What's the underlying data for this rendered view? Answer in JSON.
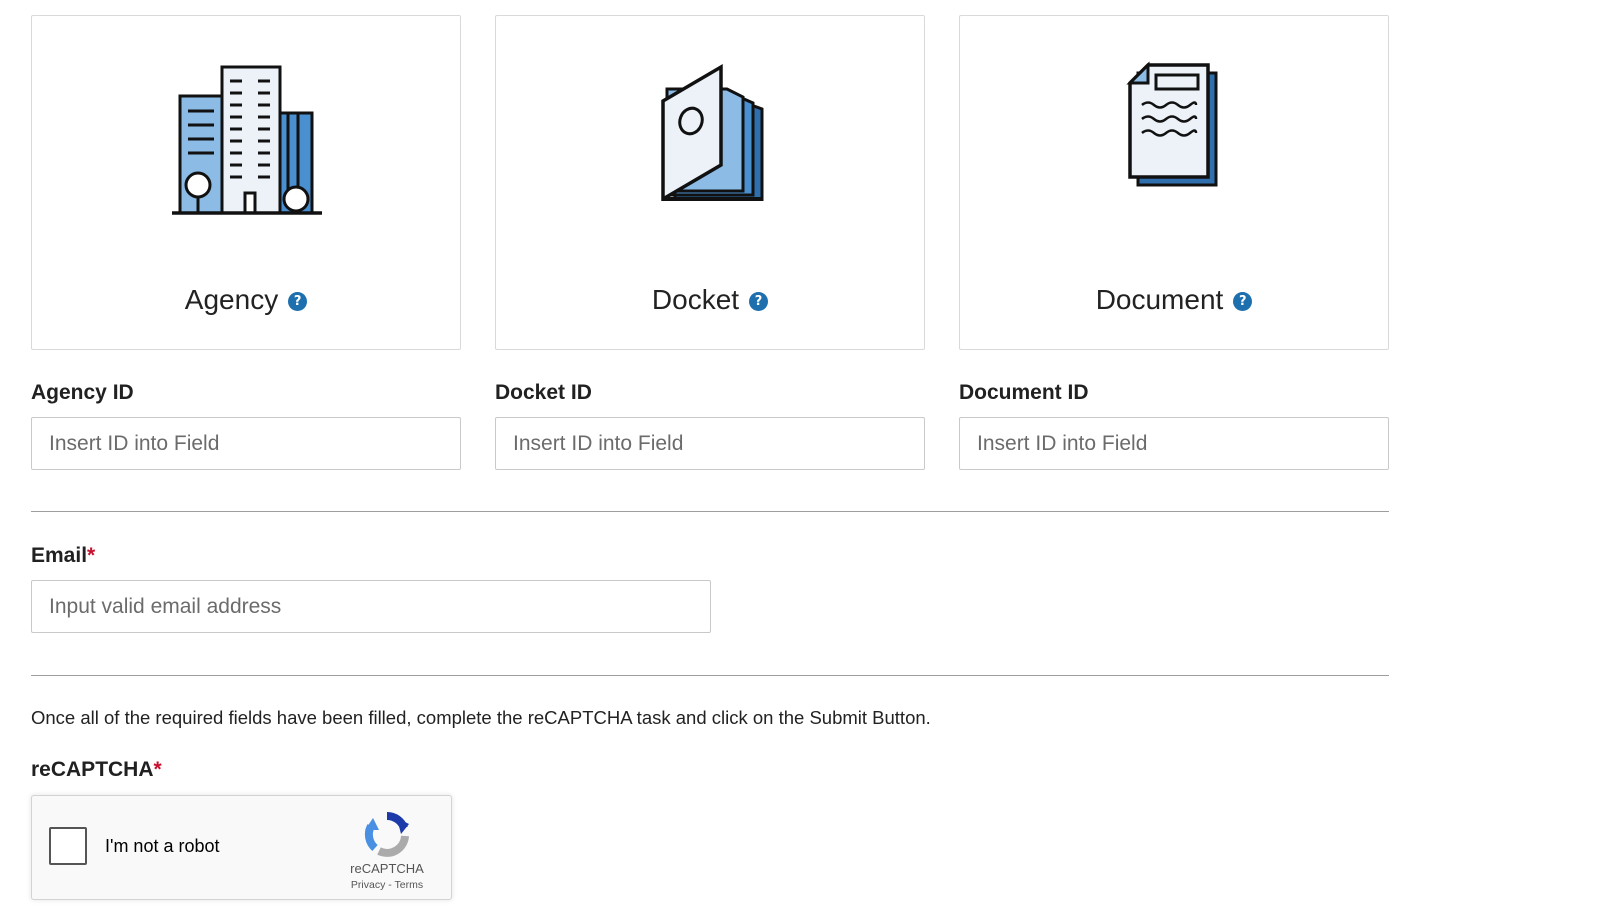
{
  "cards": [
    {
      "title": "Agency",
      "icon": "building-icon",
      "help_icon": "question-circle-icon"
    },
    {
      "title": "Docket",
      "icon": "docket-folders-icon",
      "help_icon": "question-circle-icon"
    },
    {
      "title": "Document",
      "icon": "document-pages-icon",
      "help_icon": "question-circle-icon"
    }
  ],
  "id_fields": [
    {
      "label": "Agency ID",
      "value": "",
      "placeholder": "Insert ID into Field"
    },
    {
      "label": "Docket ID",
      "value": "",
      "placeholder": "Insert ID into Field"
    },
    {
      "label": "Document ID",
      "value": "",
      "placeholder": "Insert ID into Field"
    }
  ],
  "email": {
    "label": "Email",
    "required_mark": "*",
    "value": "",
    "placeholder": "Input valid email address"
  },
  "instructions": "Once all of the required fields have been filled, complete the reCAPTCHA task and click on the Submit Button.",
  "recaptcha": {
    "label": "reCAPTCHA",
    "required_mark": "*",
    "checkbox_text": "I'm not a robot",
    "checked": false,
    "brand": "reCAPTCHA",
    "privacy_link": "Privacy",
    "separator": " - ",
    "terms_link": "Terms"
  },
  "help_glyph": "?",
  "colors": {
    "accent_blue": "#1e6fae",
    "light_blue": "#8cbce6",
    "mid_blue": "#4a8fd0",
    "required_red": "#c8102e",
    "border_gray": "#d9d9d9",
    "divider_gray": "#9e9e9e"
  }
}
